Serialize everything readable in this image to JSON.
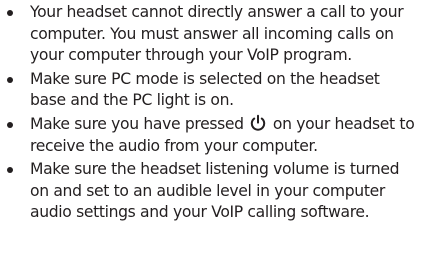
{
  "bullets": [
    {
      "text": "Your headset cannot directly answer a call to your computer. You must answer all incoming calls on your computer through your VoIP program."
    },
    {
      "text": "Make sure PC mode is selected on the headset base and the PC light is on."
    },
    {
      "text_before": "Make sure you have pressed ",
      "icon": "power-icon",
      "text_after": " on your headset to receive the audio from your computer."
    },
    {
      "text": "Make sure the headset listening volume is turned on and set to an audible level in your computer audio settings and your VoIP calling software."
    }
  ]
}
